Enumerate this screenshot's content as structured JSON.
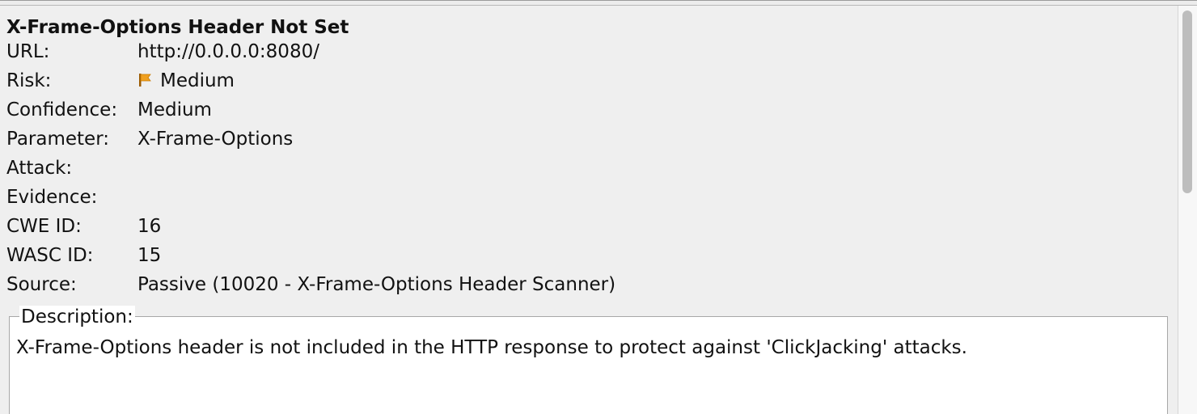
{
  "alert": {
    "title": "X-Frame-Options Header Not Set",
    "fields": [
      {
        "label": "URL:",
        "value": "http://0.0.0.0:8080/"
      },
      {
        "label": "Risk:",
        "value": "Medium",
        "icon": "flag-icon"
      },
      {
        "label": "Confidence:",
        "value": "Medium"
      },
      {
        "label": "Parameter:",
        "value": "X-Frame-Options"
      },
      {
        "label": "Attack:",
        "value": ""
      },
      {
        "label": "Evidence:",
        "value": ""
      },
      {
        "label": "CWE ID:",
        "value": "16"
      },
      {
        "label": "WASC ID:",
        "value": "15"
      },
      {
        "label": "Source:",
        "value": "Passive (10020 - X-Frame-Options Header Scanner)"
      }
    ],
    "description": {
      "legend": "Description:",
      "text": "X-Frame-Options header is not included in the HTTP response to protect against 'ClickJacking' attacks."
    }
  },
  "colors": {
    "background": "#efefef",
    "risk_flag": "#f0a020"
  }
}
